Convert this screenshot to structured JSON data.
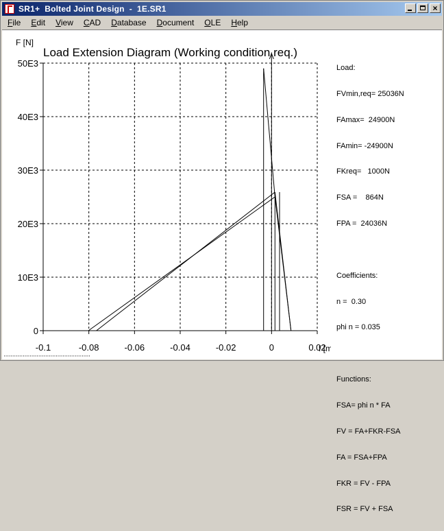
{
  "window": {
    "title": "SR1+  Bolted Joint Design  -  1E.SR1",
    "close_glyph": "×"
  },
  "menu": {
    "items": [
      {
        "pre": "",
        "u": "F",
        "rest": "ile"
      },
      {
        "pre": "",
        "u": "E",
        "rest": "dit"
      },
      {
        "pre": "",
        "u": "V",
        "rest": "iew"
      },
      {
        "pre": "",
        "u": "C",
        "rest": "AD"
      },
      {
        "pre": "",
        "u": "D",
        "rest": "atabase"
      },
      {
        "pre": "",
        "u": "D",
        "rest": "ocument"
      },
      {
        "pre": "",
        "u": "O",
        "rest": "LE"
      },
      {
        "pre": "",
        "u": "H",
        "rest": "elp"
      }
    ]
  },
  "chart_data": {
    "type": "line",
    "title": "Load Extension Diagram (Working condition req.)",
    "ylabel": "F [N]",
    "xlabel": "f [mm]",
    "xlim": [
      -0.1,
      0.02
    ],
    "ylim": [
      0,
      50000
    ],
    "x_ticks": [
      -0.1,
      -0.08,
      -0.06,
      -0.04,
      -0.02,
      0,
      0.02
    ],
    "x_tick_labels": [
      "-0.1",
      "-0.08",
      "-0.06",
      "-0.04",
      "-0.02",
      "0",
      "0.02"
    ],
    "y_ticks": [
      0,
      10000,
      20000,
      30000,
      40000,
      50000
    ],
    "y_tick_labels": [
      "0",
      "10E3",
      "20E3",
      "30E3",
      "40E3",
      "50E3"
    ],
    "grid": true,
    "series": [
      {
        "points": [
          [
            -0.0802,
            0
          ],
          [
            0.0015,
            25000
          ]
        ]
      },
      {
        "points": [
          [
            -0.0767,
            0
          ],
          [
            0.0015,
            25900
          ]
        ]
      },
      {
        "points": [
          [
            -0.0035,
            0
          ],
          [
            -0.0035,
            49000
          ]
        ]
      },
      {
        "points": [
          [
            -0.0035,
            49000
          ],
          [
            0.0015,
            25000
          ]
        ]
      },
      {
        "points": [
          [
            0.0015,
            0
          ],
          [
            0.0015,
            25000
          ]
        ]
      },
      {
        "points": [
          [
            0.0015,
            25000
          ],
          [
            0.0085,
            0
          ]
        ]
      },
      {
        "points": [
          [
            0.0015,
            25900
          ],
          [
            0.0085,
            0
          ]
        ]
      },
      {
        "points": [
          [
            0.0035,
            0
          ],
          [
            0.0035,
            25900
          ]
        ]
      },
      {
        "points": [
          [
            0.0,
            0
          ],
          [
            0.0,
            52000
          ]
        ]
      }
    ]
  },
  "sidebar": {
    "load_heading": "Load:",
    "load_lines": [
      "FVmin,req= 25036N",
      "FAmax=  24900N",
      "FAmin= -24900N",
      "FKreq=   1000N",
      "FSA =    864N",
      "FPA =  24036N"
    ],
    "coef_heading": "Coefficients:",
    "coef_lines": [
      "n =  0.30",
      "phi n = 0.035"
    ],
    "func_heading": "Functions:",
    "func_lines": [
      "FSA= phi n * FA",
      "FV = FA+FKR-FSA",
      "FA = FSA+FPA",
      "FKR = FV - FPA",
      "FSR = FV + FSA"
    ]
  },
  "footer": {
    "status_text": "▪ ▪ ▪ ▪ ▪ ▪ ▪ ▪ ▪ ▪ ▪ ▪ ▪ ▪ ▪ ▪ ▪ ▪ ▪ ▪ ▪ ▪ ▪ ▪ ▪ ▪ ▪ ▪ ▪ ▪ ▪ ▪ ▪ ▪ ▪ ▪ ▪ ▪ ▪ ▪ ▪ ▪ ▪ ▪ ▪ ▪ ▪ ▪ ▪ ▪"
  }
}
